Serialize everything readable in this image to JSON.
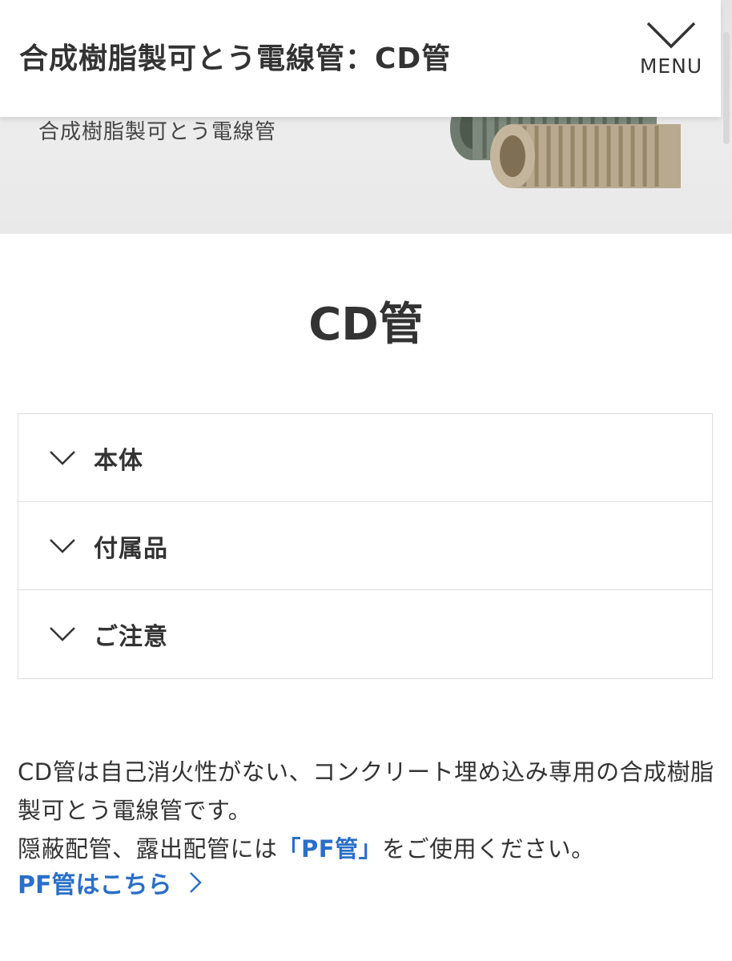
{
  "header": {
    "title": "合成樹脂製可とう電線管：CD管",
    "menu_label": "MENU",
    "menu_icon": "chevron-down-icon"
  },
  "hero": {
    "caption": "合成樹脂製可とう電線管",
    "image": "corrugated-conduit-image"
  },
  "page": {
    "title": "CD管"
  },
  "accordion": {
    "items": [
      {
        "label": "本体",
        "icon": "chevron-down-icon"
      },
      {
        "label": "付属品",
        "icon": "chevron-down-icon"
      },
      {
        "label": "ご注意",
        "icon": "chevron-down-icon"
      }
    ]
  },
  "description": {
    "line1": "CD管は自己消火性がない、コンクリート埋め込み専用の合成樹脂製可とう電線管です。",
    "line2_prefix": "隠蔽配管、露出配管には",
    "line2_link": "「PF管」",
    "line2_suffix": "をご使用ください。",
    "link_label": "PF管はこちら",
    "link_icon": "chevron-right-icon"
  },
  "colors": {
    "link": "#2a6fc9",
    "text": "#333333",
    "border": "#dcdcdc"
  }
}
